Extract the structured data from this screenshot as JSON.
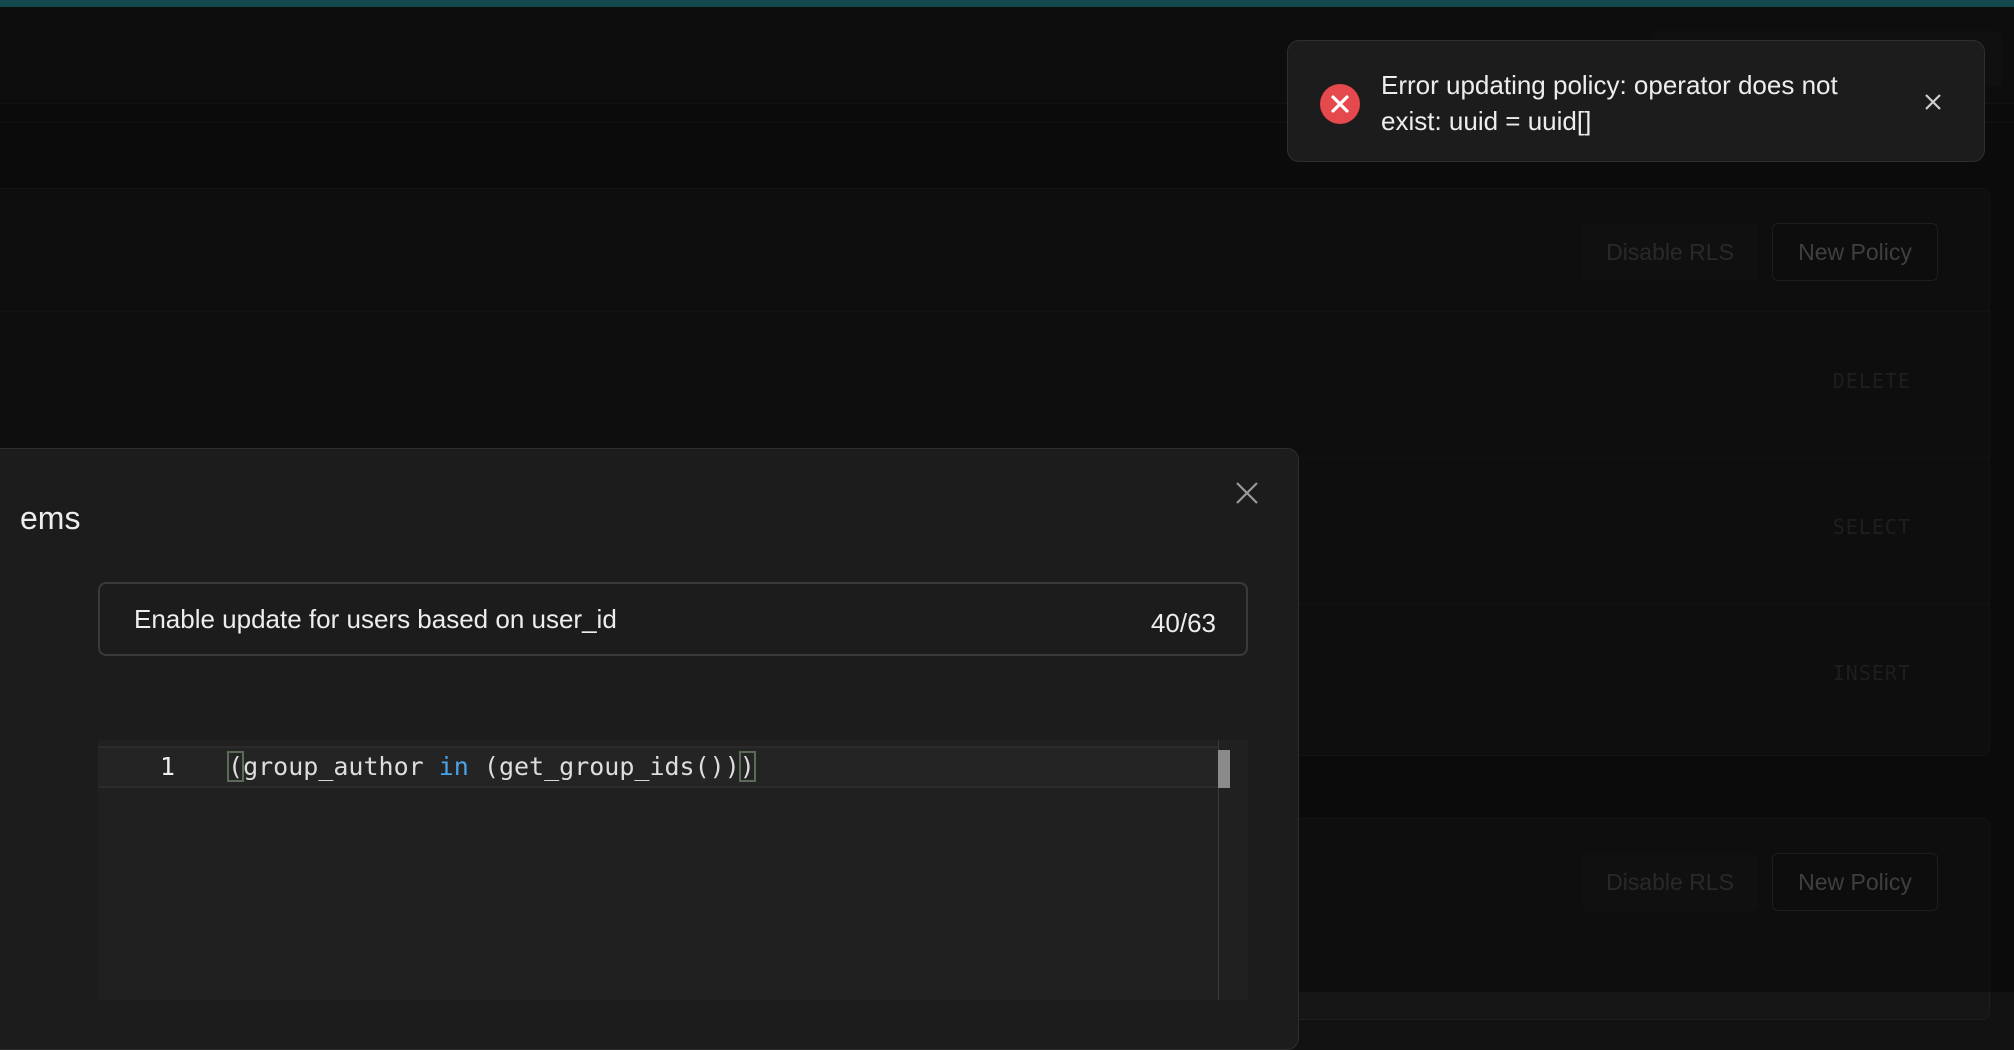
{
  "toast": {
    "message": "Error updating policy: operator does not exist: uuid = uuid[]",
    "status_color": "#e5484d",
    "icon": "error-x-icon",
    "close_icon": "close-icon"
  },
  "background": {
    "panels": [
      {
        "buttons": {
          "disable": "Disable RLS",
          "new": "New Policy"
        },
        "commands": [
          "DELETE",
          "SELECT",
          "INSERT"
        ]
      },
      {
        "buttons": {
          "disable": "Disable RLS",
          "new": "New Policy"
        }
      }
    ]
  },
  "modal": {
    "title_visible": "ems",
    "close_icon": "close-icon",
    "policy_name": {
      "value": "Enable update for users based on user_id",
      "counter": "40/63"
    },
    "editor": {
      "line_number": "1",
      "code": "(group_author in (get_group_ids()))",
      "keyword_color": "#4aa3e8"
    }
  },
  "colors": {
    "accent_topbar": "#1e6f78",
    "background": "#121212"
  }
}
